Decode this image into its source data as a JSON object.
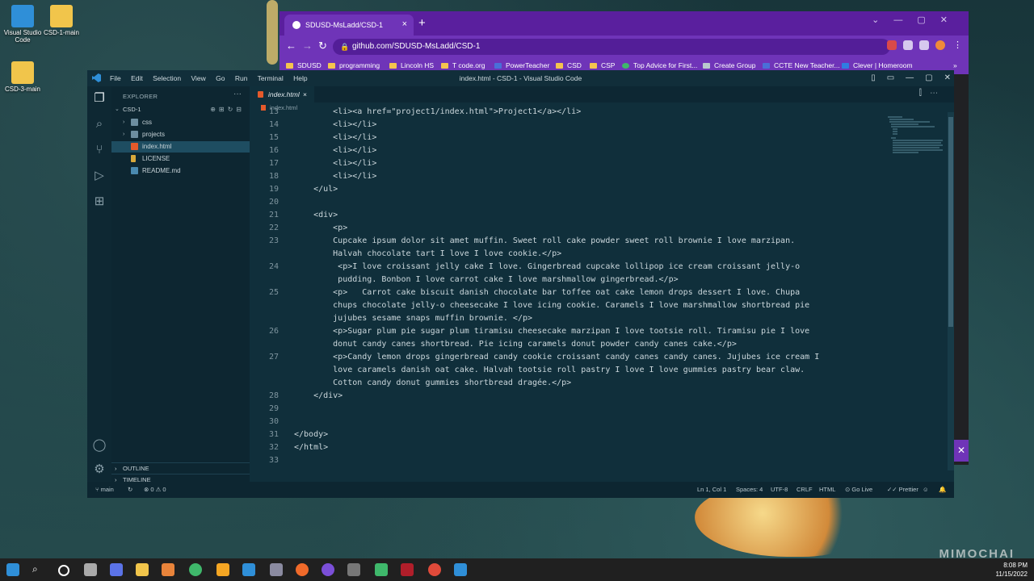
{
  "desktop": {
    "icons": [
      {
        "label": "Visual Studio Code"
      },
      {
        "label": "CSD-1-main"
      },
      {
        "label": "CSD-3-main"
      }
    ],
    "watermark": "MIMOCHAI"
  },
  "browser": {
    "tab_title": "SDUSD-MsLadd/CSD-1",
    "url": "github.com/SDUSD-MsLadd/CSD-1",
    "bookmarks": [
      "SDUSD",
      "programming",
      "Lincoln HS",
      "T code.org",
      "PowerTeacher",
      "CSD",
      "CSP",
      "Top Advice for First...",
      "Create Group",
      "CCTE New Teacher...",
      "Clever | Homeroom"
    ]
  },
  "vscode": {
    "menu": [
      "File",
      "Edit",
      "Selection",
      "View",
      "Go",
      "Run",
      "Terminal",
      "Help"
    ],
    "window_title": "index.html - CSD-1 - Visual Studio Code",
    "explorer": {
      "header": "EXPLORER",
      "root": "CSD-1",
      "items": [
        {
          "label": "css",
          "type": "folder"
        },
        {
          "label": "projects",
          "type": "folder"
        },
        {
          "label": "index.html",
          "type": "html"
        },
        {
          "label": "LICENSE",
          "type": "license"
        },
        {
          "label": "README.md",
          "type": "md"
        }
      ],
      "outline": "OUTLINE",
      "timeline": "TIMELINE"
    },
    "editor_tab": "index.html",
    "breadcrumb": "index.html",
    "code_lines": [
      {
        "n": "13",
        "text": "        <li><a href=\"project1/index.html\">Project1</a></li>"
      },
      {
        "n": "14",
        "text": "        <li></li>"
      },
      {
        "n": "15",
        "text": "        <li></li>"
      },
      {
        "n": "16",
        "text": "        <li></li>"
      },
      {
        "n": "17",
        "text": "        <li></li>"
      },
      {
        "n": "18",
        "text": "        <li></li>"
      },
      {
        "n": "19",
        "text": "    </ul>"
      },
      {
        "n": "20",
        "text": ""
      },
      {
        "n": "21",
        "text": "    <div>"
      },
      {
        "n": "22",
        "text": "        <p>"
      },
      {
        "n": "23",
        "text": "        Cupcake ipsum dolor sit amet muffin. Sweet roll cake powder sweet roll brownie I love marzipan."
      },
      {
        "n": "",
        "text": "        Halvah chocolate tart I love I love cookie.</p>"
      },
      {
        "n": "24",
        "text": "         <p>I love croissant jelly cake I love. Gingerbread cupcake lollipop ice cream croissant jelly-o"
      },
      {
        "n": "",
        "text": "         pudding. Bonbon I love carrot cake I love marshmallow gingerbread.</p>"
      },
      {
        "n": "25",
        "text": "        <p>   Carrot cake biscuit danish chocolate bar toffee oat cake lemon drops dessert I love. Chupa"
      },
      {
        "n": "",
        "text": "        chups chocolate jelly-o cheesecake I love icing cookie. Caramels I love marshmallow shortbread pie"
      },
      {
        "n": "",
        "text": "        jujubes sesame snaps muffin brownie. </p>"
      },
      {
        "n": "26",
        "text": "        <p>Sugar plum pie sugar plum tiramisu cheesecake marzipan I love tootsie roll. Tiramisu pie I love"
      },
      {
        "n": "",
        "text": "        donut candy canes shortbread. Pie icing caramels donut powder candy canes cake.</p>"
      },
      {
        "n": "27",
        "text": "        <p>Candy lemon drops gingerbread candy cookie croissant candy canes candy canes. Jujubes ice cream I"
      },
      {
        "n": "",
        "text": "        love caramels danish oat cake. Halvah tootsie roll pastry I love I love gummies pastry bear claw."
      },
      {
        "n": "",
        "text": "        Cotton candy donut gummies shortbread dragée.</p>"
      },
      {
        "n": "28",
        "text": "    </div>"
      },
      {
        "n": "29",
        "text": ""
      },
      {
        "n": "30",
        "text": ""
      },
      {
        "n": "31",
        "text": "</body>"
      },
      {
        "n": "32",
        "text": "</html>"
      },
      {
        "n": "33",
        "text": ""
      }
    ],
    "status": {
      "branch": "main",
      "problems": "⊗ 0 ⚠ 0",
      "position": "Ln 1, Col 1",
      "spaces": "Spaces: 4",
      "encoding": "UTF-8",
      "eol": "CRLF",
      "language": "HTML",
      "golive": "Go Live",
      "prettier": "Prettier"
    }
  },
  "taskbar": {
    "time": "8:08 PM",
    "date": "11/15/2022"
  },
  "colors": {
    "chrome_purple": "#6f34b8",
    "vscode_bg": "#102f3b",
    "accent_html": "#e45a2b"
  }
}
